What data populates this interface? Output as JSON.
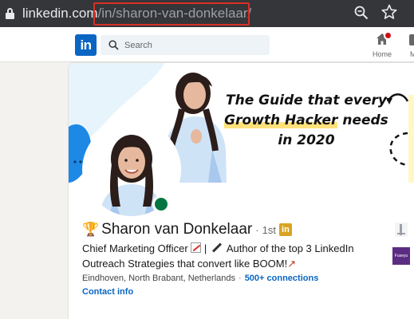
{
  "browser": {
    "url_domain": "linkedin.com",
    "url_path": "/in/sharon-van-donkelaar/",
    "highlight_color": "#d93025"
  },
  "nav": {
    "logo_text": "in",
    "search_placeholder": "Search",
    "home_label": "Home",
    "more_label": "M"
  },
  "profile": {
    "banner_line1": "The Guide that every",
    "banner_line2_highlight": "Growth Hacker",
    "banner_line2_rest": " needs",
    "banner_line3": "in 2020",
    "name": "Sharon van Donkelaar",
    "name_separator": "·",
    "degree": "1st",
    "in_badge": "in",
    "headline_part1": "Chief Marketing Officer ",
    "headline_part2": " | ",
    "headline_part3": " Author of the top 3 LinkedIn Outreach Strategies that convert like BOOM!",
    "location": "Eindhoven, North Brabant, Netherlands",
    "separator": "·",
    "connections": "500+ connections",
    "contact_info": "Contact info",
    "side_logo2_text": "Fuseyu"
  },
  "colors": {
    "linkedin_blue": "#0a66c2",
    "online_green": "#057642",
    "notification_red": "#cc1016"
  }
}
